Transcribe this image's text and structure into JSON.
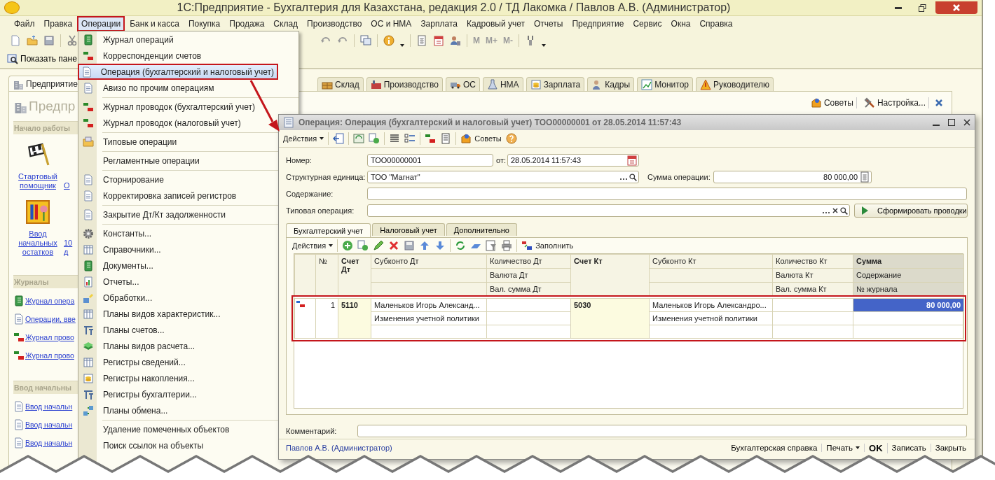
{
  "window": {
    "title": "1С:Предприятие - Бухгалтерия для Казахстана, редакция 2.0 / ТД Лакомка / Павлов А.В. (Администратор)",
    "menu": [
      {
        "label": "Файл",
        "selected": false
      },
      {
        "label": "Правка",
        "selected": false
      },
      {
        "label": "Операции",
        "selected": true
      },
      {
        "label": "Банк и касса",
        "selected": false
      },
      {
        "label": "Покупка",
        "selected": false
      },
      {
        "label": "Продажа",
        "selected": false
      },
      {
        "label": "Склад",
        "selected": false
      },
      {
        "label": "Производство",
        "selected": false
      },
      {
        "label": "ОС и НМА",
        "selected": false
      },
      {
        "label": "Зарплата",
        "selected": false
      },
      {
        "label": "Кадровый учет",
        "selected": false
      },
      {
        "label": "Отчеты",
        "selected": false
      },
      {
        "label": "Предприятие",
        "selected": false
      },
      {
        "label": "Сервис",
        "selected": false
      },
      {
        "label": "Окна",
        "selected": false
      },
      {
        "label": "Справка",
        "selected": false
      }
    ],
    "toolbar_memory": [
      "M",
      "M+",
      "M-"
    ],
    "panel_button": "Показать пане"
  },
  "tabs": [
    {
      "label": "Предприятие",
      "selected": true
    },
    {
      "label": "Склад",
      "selected": false
    },
    {
      "label": "Производство",
      "selected": false
    },
    {
      "label": "ОС",
      "selected": false
    },
    {
      "label": "НМА",
      "selected": false
    },
    {
      "label": "Зарплата",
      "selected": false
    },
    {
      "label": "Кадры",
      "selected": false
    },
    {
      "label": "Монитор",
      "selected": false
    },
    {
      "label": "Руководителю",
      "selected": false
    }
  ],
  "panel_actions": [
    "Советы",
    "Настройка..."
  ],
  "sidebar": {
    "heading": "Предпр",
    "sections": [
      {
        "title": "Начало работы",
        "kind": "tiles",
        "items": [
          "Стартовый помощник",
          "О",
          "Ввод начальных остатков",
          "10 д"
        ]
      },
      {
        "title": "Журналы",
        "kind": "links",
        "items": [
          "Журнал опера",
          "Операции, вве",
          "Журнал прово",
          "Журнал прово"
        ]
      },
      {
        "title": "Ввод начальны",
        "kind": "links",
        "items": [
          "Ввод начальн",
          "Ввод начальн",
          "Ввод начальн"
        ]
      }
    ]
  },
  "dropdown": {
    "items": [
      {
        "kind": "item",
        "label": "Журнал операций",
        "selected": false
      },
      {
        "kind": "item",
        "label": "Корреспонденции счетов",
        "selected": false
      },
      {
        "kind": "item",
        "label": "Операция (бухгалтерский и налоговый учет)",
        "selected": true
      },
      {
        "kind": "item",
        "label": "Авизо по прочим операциям",
        "selected": false
      },
      {
        "kind": "separator"
      },
      {
        "kind": "item",
        "label": "Журнал проводок (бухгалтерский учет)",
        "selected": false
      },
      {
        "kind": "item",
        "label": "Журнал проводок (налоговый учет)",
        "selected": false
      },
      {
        "kind": "separator"
      },
      {
        "kind": "item",
        "label": "Типовые операции",
        "selected": false
      },
      {
        "kind": "separator"
      },
      {
        "kind": "item",
        "label": "Регламентные операции",
        "selected": false
      },
      {
        "kind": "separator"
      },
      {
        "kind": "item",
        "label": "Сторнирование",
        "selected": false
      },
      {
        "kind": "item",
        "label": "Корректировка записей регистров",
        "selected": false
      },
      {
        "kind": "separator"
      },
      {
        "kind": "item",
        "label": "Закрытие Дт/Кт задолженности",
        "selected": false
      },
      {
        "kind": "separator"
      },
      {
        "kind": "item",
        "label": "Константы...",
        "selected": false
      },
      {
        "kind": "item",
        "label": "Справочники...",
        "selected": false
      },
      {
        "kind": "item",
        "label": "Документы...",
        "selected": false
      },
      {
        "kind": "item",
        "label": "Отчеты...",
        "selected": false
      },
      {
        "kind": "item",
        "label": "Обработки...",
        "selected": false
      },
      {
        "kind": "item",
        "label": "Планы видов характеристик...",
        "selected": false
      },
      {
        "kind": "item",
        "label": "Планы счетов...",
        "selected": false
      },
      {
        "kind": "item",
        "label": "Планы видов расчета...",
        "selected": false
      },
      {
        "kind": "item",
        "label": "Регистры сведений...",
        "selected": false
      },
      {
        "kind": "item",
        "label": "Регистры накопления...",
        "selected": false
      },
      {
        "kind": "item",
        "label": "Регистры бухгалтерии...",
        "selected": false
      },
      {
        "kind": "item",
        "label": "Планы обмена...",
        "selected": false
      },
      {
        "kind": "separator"
      },
      {
        "kind": "item",
        "label": "Удаление помеченных объектов",
        "selected": false
      },
      {
        "kind": "item",
        "label": "Поиск ссылок на объекты",
        "selected": false
      }
    ]
  },
  "dialog": {
    "title": "Операция: Операция (бухгалтерский и налоговый учет) ТОО00000001 от 28.05.2014 11:57:43",
    "toolbar": {
      "actions": "Действия",
      "tips": "Советы"
    },
    "number": {
      "label": "Номер:",
      "value": "ТОО00000001"
    },
    "date": {
      "label": "от:",
      "value": "28.05.2014 11:57:43"
    },
    "unit": {
      "label": "Структурная единица:",
      "value": "ТОО \"Магнат\""
    },
    "amount": {
      "label": "Сумма операции:",
      "value": "80 000,00"
    },
    "content": {
      "label": "Содержание:"
    },
    "template": {
      "label": "Типовая операция:"
    },
    "generate_button": "Сформировать проводки",
    "tabs": [
      {
        "label": "Бухгалтерский учет",
        "selected": true
      },
      {
        "label": "Налоговый учет",
        "selected": false
      },
      {
        "label": "Дополнительно",
        "selected": false
      }
    ],
    "table_toolbar": {
      "actions": "Действия",
      "fill": "Заполнить"
    },
    "columns": [
      {
        "kind": "number",
        "label": "№",
        "current": false
      },
      {
        "kind": "account",
        "label": "Счет Дт",
        "current": false
      },
      {
        "kind": "lines",
        "lines": [
          "Субконто Дт"
        ],
        "current": false
      },
      {
        "kind": "lines",
        "lines": [
          "Количество Дт",
          "Валюта Дт",
          "Вал. сумма Дт"
        ],
        "current": false
      },
      {
        "kind": "account",
        "label": "Счет Кт",
        "current": false
      },
      {
        "kind": "lines",
        "lines": [
          "Субконто Кт"
        ],
        "current": false
      },
      {
        "kind": "lines",
        "lines": [
          "Количество Кт",
          "Валюта Кт",
          "Вал. сумма Кт"
        ],
        "current": false
      },
      {
        "kind": "lines",
        "lines": [
          "Сумма",
          "Содержание",
          "№ журнала"
        ],
        "current": true
      }
    ],
    "rows": [
      {
        "cells": [
          {
            "text": "1"
          },
          {
            "text": "5110"
          },
          {
            "lines": [
              "Маленьков Игорь Александ...",
              "Изменения учетной политики"
            ],
            "selected": false
          },
          {
            "selected": false
          },
          {
            "text": "5030"
          },
          {
            "lines": [
              "Маленьков Игорь Александро...",
              "Изменения учетной политики"
            ],
            "selected": false
          },
          {
            "selected": false
          },
          {
            "lines": [
              "80 000,00"
            ],
            "selected": true
          }
        ]
      }
    ],
    "comment": {
      "label": "Комментарий:"
    },
    "status": {
      "user": "Павлов А.В. (Администратор)",
      "buttons": [
        {
          "label": "Бухгалтерская справка",
          "dropdown": false,
          "default": false
        },
        {
          "label": "Печать",
          "dropdown": true,
          "default": false
        },
        {
          "label": "OK",
          "dropdown": false,
          "default": true
        },
        {
          "label": "Записать",
          "dropdown": false,
          "default": false
        },
        {
          "label": "Закрыть",
          "dropdown": false,
          "default": false
        }
      ]
    }
  }
}
